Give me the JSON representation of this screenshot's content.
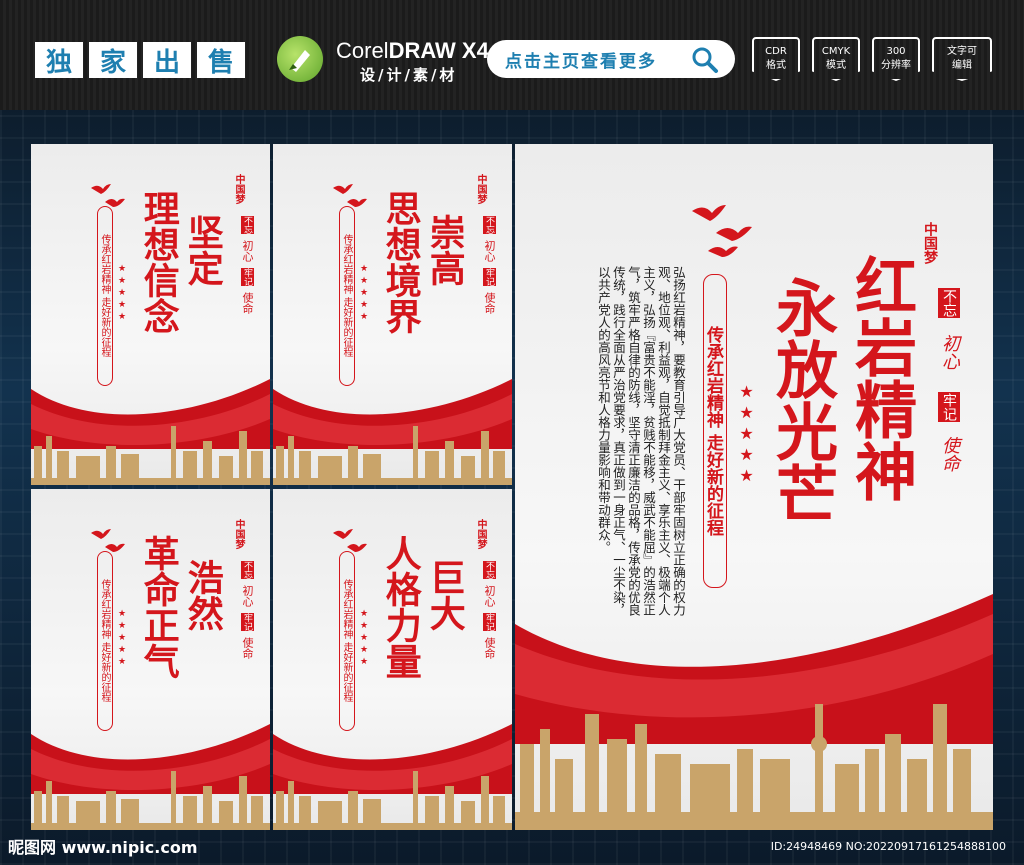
{
  "header": {
    "exclusive_chars": [
      "独",
      "家",
      "出",
      "售"
    ],
    "corel_title_prefix": "Corel",
    "corel_title_bold": "DRAW X4",
    "corel_subtitle": "设/计/素/材",
    "search_label": "点击主页查看更多",
    "badges": [
      {
        "line1": "CDR",
        "line2": "格式"
      },
      {
        "line1": "CMYK",
        "line2": "模式"
      },
      {
        "line1": "300",
        "line2": "分辨率"
      },
      {
        "line1": "文字可",
        "line2": "编辑"
      }
    ]
  },
  "common": {
    "slogan": "传承红岩精神 走好新的征程",
    "motto_a": "不忘",
    "motto_b": "初心",
    "motto_c": "牢记",
    "motto_d": "使命",
    "dream_seal": "中国梦",
    "stars": "★★★★★"
  },
  "panels": [
    {
      "line1": "理想信念",
      "line2": "坚定"
    },
    {
      "line1": "思想境界",
      "line2": "崇高"
    },
    {
      "line1": "革命正气",
      "line2": "浩然"
    },
    {
      "line1": "人格力量",
      "line2": "巨大"
    }
  ],
  "main_panel": {
    "title_line1": "红岩精神",
    "title_line2": "永放光芒",
    "body": "弘扬红岩精神，要教育引导广大党员、干部牢固树立正确的权力观、地位观、利益观，自觉抵制拜金主义、享乐主义、极端个人主义，弘扬『富贵不能淫，贫贱不能移，威武不能屈』的浩然正气，筑牢严格自律的防线，坚守清正廉洁的品格，传承党的优良传统，践行全面从严治党要求，真正做到一身正气、一尘不染，以共产党人的高风亮节和人格力量影响和带动群众。"
  },
  "footer": {
    "logo": "昵图网 www.nipic.com",
    "id": "ID:24948469 NO:20220917161254888100"
  }
}
